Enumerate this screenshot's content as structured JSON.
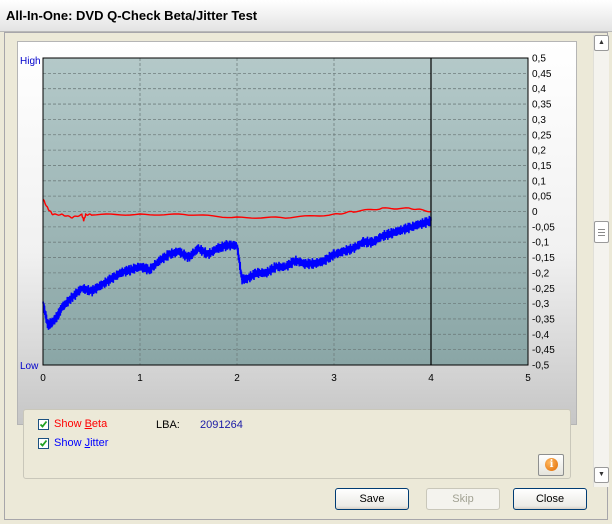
{
  "window": {
    "title": "All-In-One: DVD Q-Check Beta/Jitter Test"
  },
  "colors": {
    "beta": "#ff0000",
    "jitter": "#0000ff",
    "plot_bg_top": "#b4c9c9",
    "plot_bg_bottom": "#8aa6a6"
  },
  "chart_data": {
    "type": "line",
    "x": {
      "min": 0,
      "max": 5,
      "ticks": [
        "0",
        "1",
        "2",
        "3",
        "4",
        "5"
      ]
    },
    "y_left_labels": {
      "top": "High",
      "bottom": "Low"
    },
    "y_right": {
      "min": -0.5,
      "max": 0.5,
      "ticks": [
        "0,5",
        "0,45",
        "0,4",
        "0,35",
        "0,3",
        "0,25",
        "0,2",
        "0,15",
        "0,1",
        "0,05",
        "0",
        "-0,05",
        "-0,1",
        "-0,15",
        "-0,2",
        "-0,25",
        "-0,3",
        "-0,35",
        "-0,4",
        "-0,45",
        "-0,5"
      ]
    },
    "progress_marker_x": 4,
    "grid": true,
    "series": [
      {
        "key": "beta",
        "x": [
          0,
          0.05,
          0.1,
          0.2,
          0.3,
          0.4,
          0.42,
          0.44,
          0.5,
          1.0,
          1.5,
          2.0,
          2.5,
          3.0,
          3.2,
          3.5,
          3.8,
          4.0
        ],
        "values": [
          0.04,
          0.01,
          -0.01,
          -0.01,
          -0.02,
          -0.01,
          -0.03,
          -0.01,
          -0.01,
          -0.01,
          -0.01,
          -0.02,
          -0.02,
          -0.01,
          0.0,
          0.01,
          0.01,
          0.0
        ]
      },
      {
        "key": "jitter",
        "x": [
          0,
          0.05,
          0.1,
          0.15,
          0.2,
          0.3,
          0.4,
          0.5,
          0.6,
          0.7,
          0.8,
          0.9,
          1.0,
          1.1,
          1.2,
          1.3,
          1.4,
          1.5,
          1.6,
          1.7,
          1.8,
          1.9,
          2.0,
          2.05,
          2.1,
          2.2,
          2.3,
          2.4,
          2.5,
          2.6,
          2.7,
          2.8,
          2.9,
          3.0,
          3.1,
          3.2,
          3.3,
          3.4,
          3.5,
          3.6,
          3.7,
          3.8,
          3.9,
          4.0
        ],
        "values": [
          -0.3,
          -0.37,
          -0.36,
          -0.34,
          -0.31,
          -0.28,
          -0.25,
          -0.26,
          -0.24,
          -0.22,
          -0.2,
          -0.19,
          -0.18,
          -0.19,
          -0.16,
          -0.14,
          -0.13,
          -0.15,
          -0.12,
          -0.14,
          -0.12,
          -0.11,
          -0.11,
          -0.22,
          -0.22,
          -0.2,
          -0.2,
          -0.18,
          -0.18,
          -0.16,
          -0.17,
          -0.17,
          -0.16,
          -0.14,
          -0.13,
          -0.12,
          -0.1,
          -0.1,
          -0.08,
          -0.07,
          -0.06,
          -0.05,
          -0.04,
          -0.03
        ]
      }
    ]
  },
  "options": {
    "show_beta": {
      "prefix": "Show ",
      "accel": "B",
      "rest": "eta",
      "checked": true
    },
    "show_jitter": {
      "prefix": "Show ",
      "accel": "J",
      "rest": "itter",
      "checked": true
    },
    "lba_label": "LBA:",
    "lba_value": "2091264"
  },
  "buttons": {
    "save": "Save",
    "skip": "Skip",
    "close": "Close"
  },
  "icons": {
    "info": "i"
  }
}
